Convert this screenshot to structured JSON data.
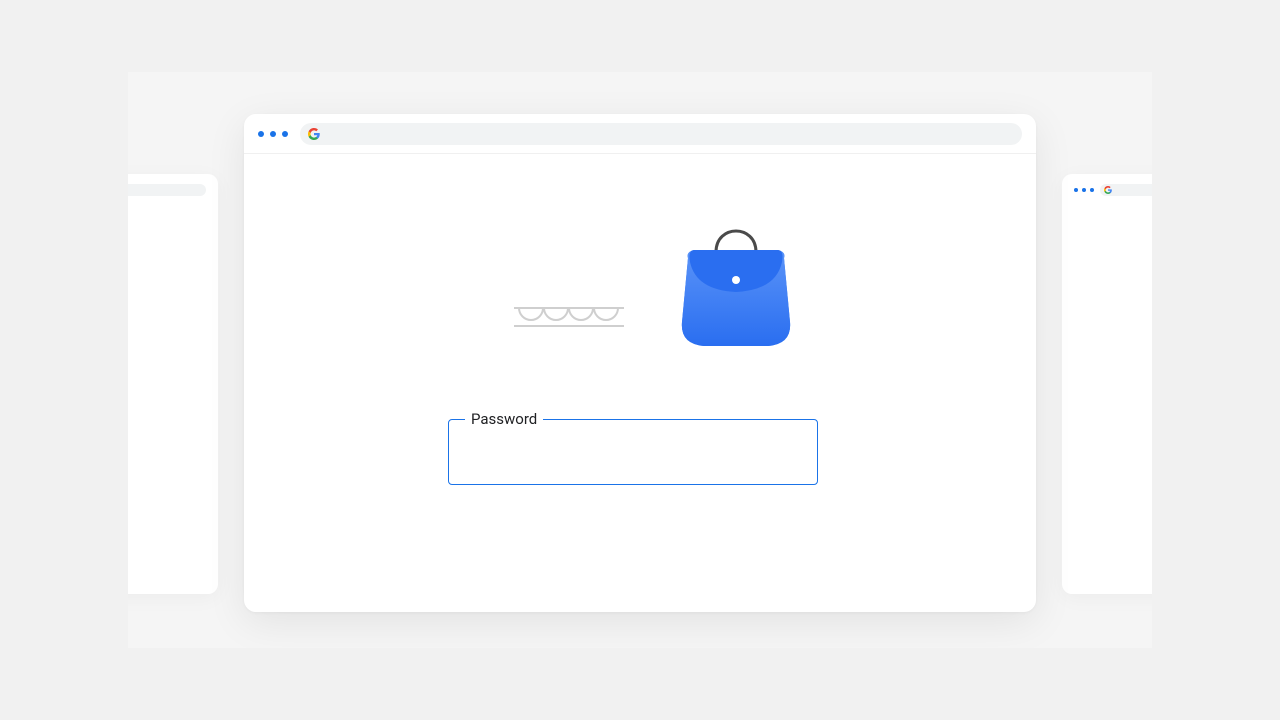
{
  "form": {
    "password_label": "Password",
    "password_value": ""
  },
  "icons": {
    "g_logo": "google-g-logo",
    "bag": "handbag-icon",
    "scallop": "scallop-decoration-icon",
    "window_controls": "window-control-dots"
  }
}
